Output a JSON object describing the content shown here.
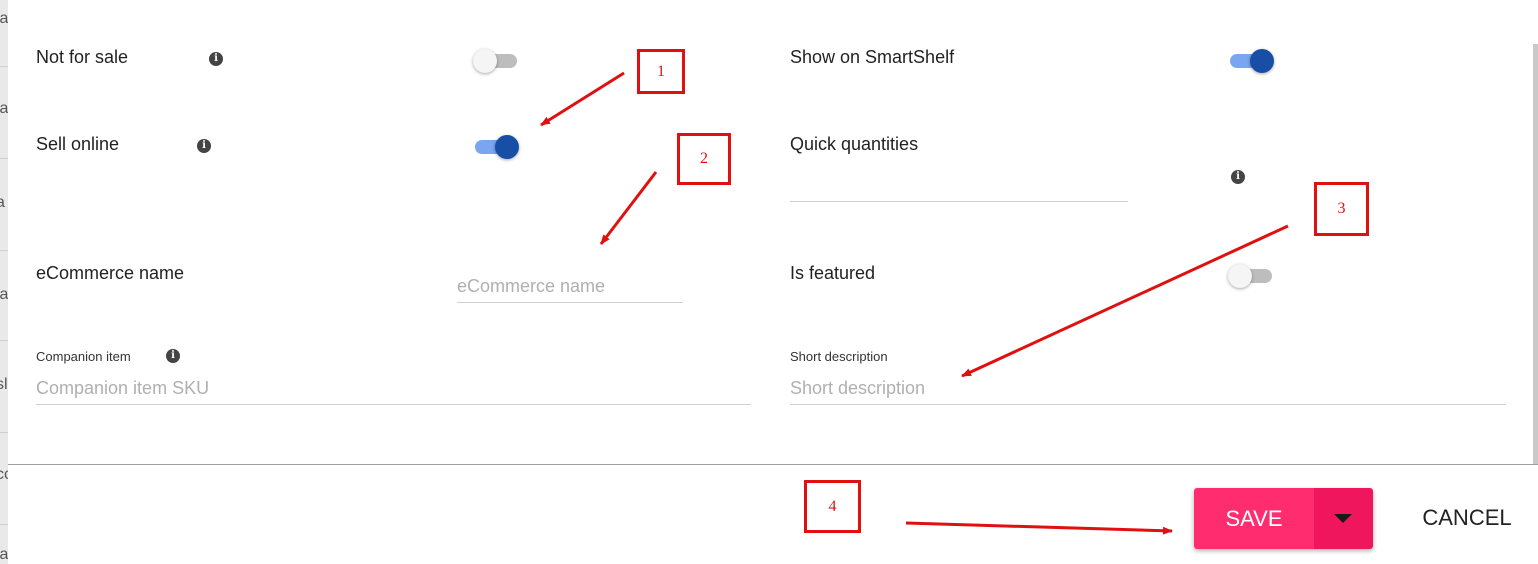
{
  "left_strip": [
    "ia",
    "ia",
    "a",
    "ia",
    "sl",
    "cc",
    "ia"
  ],
  "fields": {
    "not_for_sale": {
      "label": "Not for sale",
      "toggle": "off"
    },
    "sell_online": {
      "label": "Sell online",
      "toggle": "on"
    },
    "ecommerce_name": {
      "label": "eCommerce name",
      "placeholder": "eCommerce name",
      "value": ""
    },
    "companion_item": {
      "label": "Companion item",
      "placeholder": "Companion item SKU",
      "value": ""
    },
    "show_on_smartshelf": {
      "label": "Show on SmartShelf",
      "toggle": "on"
    },
    "quick_quantities": {
      "label": "Quick quantities",
      "value": ""
    },
    "is_featured": {
      "label": "Is featured",
      "toggle": "off"
    },
    "short_description": {
      "label": "Short description",
      "placeholder": "Short description",
      "value": ""
    }
  },
  "info_icon_glyph": "i",
  "footer": {
    "save_label": "SAVE",
    "cancel_label": "CANCEL"
  },
  "annotations": [
    "1",
    "2",
    "3",
    "4"
  ],
  "colors": {
    "save": "#ff2d6f",
    "save_menu": "#f0165e",
    "toggle_on_thumb": "#174ea6",
    "toggle_on_track": "#7aa5f0",
    "annotation": "#e01010"
  }
}
